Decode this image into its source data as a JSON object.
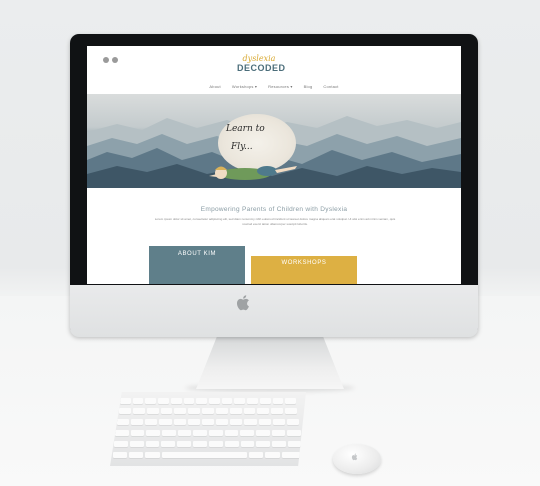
{
  "site": {
    "social_icons": [
      "facebook-icon",
      "instagram-icon"
    ],
    "logo": {
      "line1": "dyslexia",
      "line2": "DECODED"
    },
    "nav": [
      "About",
      "Workshops ▾",
      "Resources ▾",
      "Blog",
      "Contact"
    ],
    "hero": {
      "script_line1": "Learn to",
      "script_line2": "Fly..."
    },
    "tagline": "Empowering Parents of Children with Dyslexia",
    "intro": "Lorem ipsum dolor sit amet, consectetur adipiscing elit, sed diam nonummy nibh euismod tincidunt ut laoreet dolore magna aliquam erat volutpat. Ut wisi enim ad minim veniam, quis nostrud exerci tation ullamcorper suscipit lobortis.",
    "buttons": {
      "about": "ABOUT KIM",
      "workshops": "WORKSHOPS"
    }
  },
  "colors": {
    "accent_blue": "#5f7f8a",
    "accent_gold": "#ddb043",
    "logo_blue": "#4b6d7a"
  },
  "device": {
    "brand_icon": "apple-logo-icon"
  }
}
